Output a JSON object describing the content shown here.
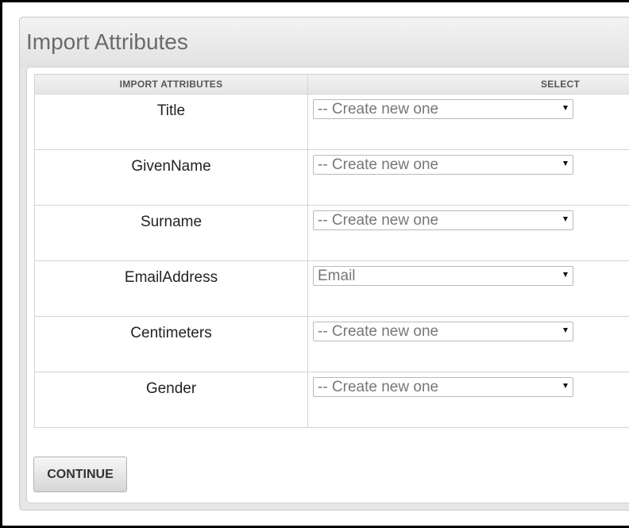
{
  "panel": {
    "title": "Import Attributes"
  },
  "table": {
    "headers": [
      "IMPORT ATTRIBUTES",
      "SELECT"
    ],
    "rows": [
      {
        "attribute": "Title",
        "selected": "-- Create new one"
      },
      {
        "attribute": "GivenName",
        "selected": "-- Create new one"
      },
      {
        "attribute": "Surname",
        "selected": "-- Create new one"
      },
      {
        "attribute": "EmailAddress",
        "selected": "Email"
      },
      {
        "attribute": "Centimeters",
        "selected": "-- Create new one"
      },
      {
        "attribute": "Gender",
        "selected": "-- Create new one"
      }
    ]
  },
  "actions": {
    "continue_label": "CONTINUE"
  }
}
